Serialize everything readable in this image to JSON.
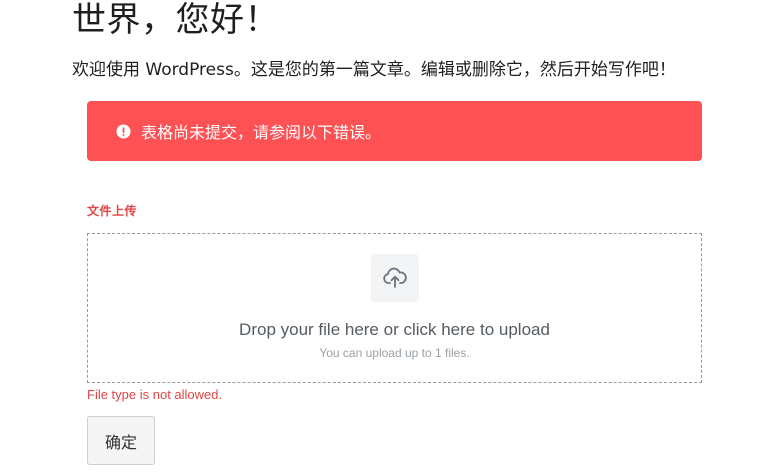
{
  "post": {
    "title": "世界，您好！",
    "intro": "欢迎使用 WordPress。这是您的第一篇文章。编辑或删除它，然后开始写作吧！"
  },
  "form": {
    "error_banner": {
      "icon": "alert-circle-icon",
      "message": "表格尚未提交，请参阅以下错误。",
      "background_color": "#fd5153"
    },
    "file_upload": {
      "label": "文件上传",
      "icon": "cloud-upload-icon",
      "drop_text": "Drop your file here or click here to upload",
      "limit_text": "You can upload up to 1 files.",
      "error_text": "File type is not allowed.",
      "error_color": "#e04646"
    },
    "submit_label": "确定"
  }
}
